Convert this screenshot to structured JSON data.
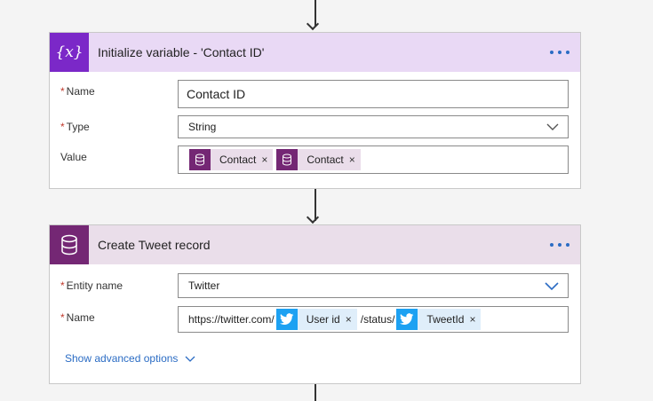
{
  "colors": {
    "variable_accent": "#7b28c8",
    "variable_header_bg": "#e9d9f5",
    "dataverse_accent": "#742774",
    "dataverse_header_bg": "#eadeea",
    "twitter_blue": "#1da1f2",
    "link_blue": "#2b6cc4"
  },
  "step1": {
    "icon": "variable-icon",
    "icon_glyph": "{x}",
    "title": "Initialize variable - 'Contact ID'",
    "more_icon": "ellipsis-icon",
    "name_label": "Name",
    "name_value": "Contact ID",
    "type_label": "Type",
    "type_value": "String",
    "value_label": "Value",
    "value_tokens": [
      {
        "label": "Contact",
        "icon": "dataverse-icon"
      },
      {
        "label": "Contact",
        "icon": "dataverse-icon"
      }
    ]
  },
  "step2": {
    "icon": "dataverse-icon",
    "title": "Create Tweet record",
    "more_icon": "ellipsis-icon",
    "entity_label": "Entity name",
    "entity_value": "Twitter",
    "name_label": "Name",
    "name_prefix": "https://twitter.com/",
    "token1": {
      "label": "User id",
      "icon": "twitter-icon"
    },
    "name_middle": "/status/",
    "token2": {
      "label": "TweetId",
      "icon": "twitter-icon"
    },
    "advanced_link": "Show advanced options"
  },
  "required_marker": "*",
  "remove_glyph": "×"
}
